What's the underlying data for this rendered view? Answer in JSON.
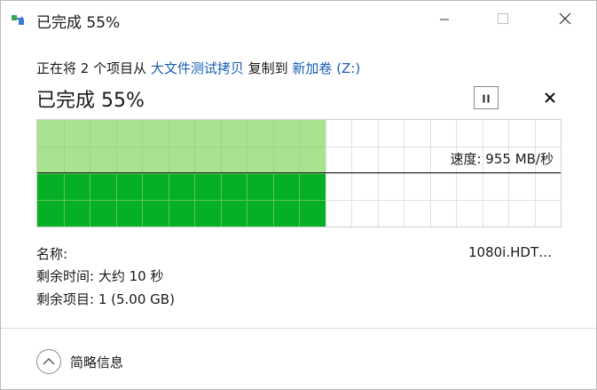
{
  "window": {
    "title": "已完成 55%"
  },
  "copy": {
    "prefix": "正在将 2 个项目从 ",
    "source": "大文件测试拷贝",
    "middle": " 复制到 ",
    "destination": "新加卷 (Z:)"
  },
  "progress": {
    "status": "已完成 55%",
    "percent": 55,
    "speed_label": "速度: 955 MB/秒"
  },
  "details": {
    "name_label": "名称:",
    "file_name": "1080i.HDT…",
    "time_remaining": "剩余时间: 大约 10 秒",
    "items_remaining": "剩余项目: 1 (5.00 GB)"
  },
  "footer": {
    "toggle_label": "简略信息"
  },
  "colors": {
    "graph_fill_light": "#a8e38f",
    "graph_fill_dark": "#06b025",
    "grid": "#e2e2e2",
    "link": "#1a5fb4"
  }
}
